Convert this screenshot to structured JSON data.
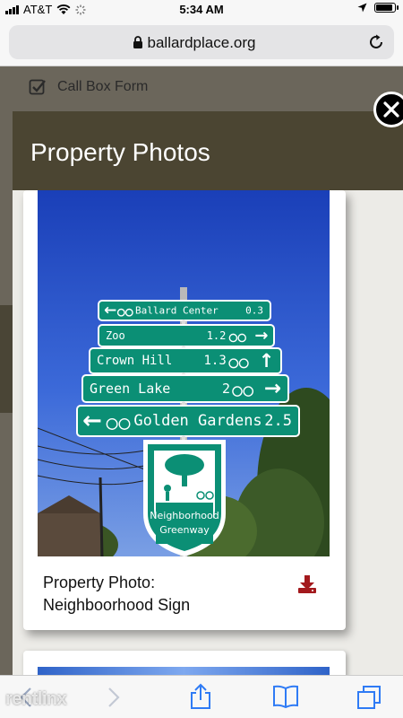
{
  "status_bar": {
    "carrier": "AT&T",
    "time": "5:34 AM",
    "battery_level": 0.9
  },
  "browser": {
    "url": "ballardplace.org"
  },
  "page": {
    "call_box_label": "Call Box Form"
  },
  "modal": {
    "title": "Property Photos",
    "photo": {
      "signs": [
        {
          "text": "Ballard Center",
          "distance": "0.3",
          "arrow": "left"
        },
        {
          "text": "Zoo",
          "distance": "1.2",
          "arrow": "right"
        },
        {
          "text": "Crown Hill",
          "distance": "1.3",
          "arrow": "up"
        },
        {
          "text": "Green Lake",
          "distance": "2",
          "arrow": "right"
        },
        {
          "text": "Golden Gardens",
          "distance": "2.5",
          "arrow": "left"
        }
      ],
      "greenway_line1": "Neighborhood",
      "greenway_line2": "Greenway"
    },
    "caption_line1": "Property Photo:",
    "caption_line2": "Neighboorhood Sign",
    "accent_color": "#a3191d"
  },
  "watermark": "rentlinx"
}
